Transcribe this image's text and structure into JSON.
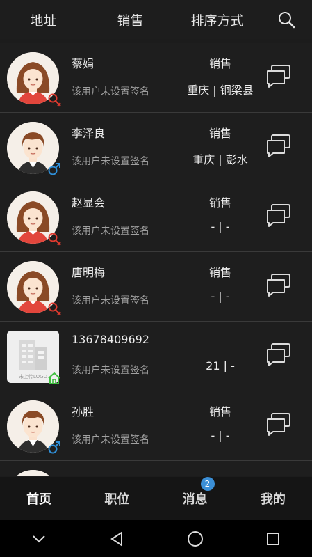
{
  "filters": {
    "address": "地址",
    "sales": "销售",
    "sort": "排序方式"
  },
  "signature_default": "该用户未设置签名",
  "rows": [
    {
      "name": "蔡娟",
      "job": "销售",
      "location": "重庆 | 铜梁县",
      "avatar": "female-avatar",
      "gender": "female"
    },
    {
      "name": "李泽良",
      "job": "销售",
      "location": "重庆 | 彭水",
      "avatar": "male-avatar",
      "gender": "male"
    },
    {
      "name": "赵显会",
      "job": "销售",
      "location": "- | -",
      "avatar": "female-avatar",
      "gender": "female"
    },
    {
      "name": "唐明梅",
      "job": "销售",
      "location": "- | -",
      "avatar": "female-avatar",
      "gender": "female"
    },
    {
      "name": "13678409692",
      "job": "",
      "location": "21 | -",
      "avatar": "company-logo-placeholder",
      "gender": "company",
      "logo_text": "未上传LOGO"
    },
    {
      "name": "孙胜",
      "job": "销售",
      "location": "- | -",
      "avatar": "male-avatar",
      "gender": "male"
    },
    {
      "name": "代华宇",
      "job": "销售",
      "location": "",
      "avatar": "female-avatar",
      "gender": "female"
    }
  ],
  "tabs": [
    {
      "label": "首页",
      "active": true
    },
    {
      "label": "职位",
      "active": false
    },
    {
      "label": "消息",
      "active": false,
      "badge": "2"
    },
    {
      "label": "我的",
      "active": false
    }
  ],
  "colors": {
    "background": "#1c1c1c",
    "female_icon": "#e03a2f",
    "male_icon": "#2f8fd8",
    "company_icon": "#3fbf3f",
    "badge": "#3b8fd6"
  }
}
